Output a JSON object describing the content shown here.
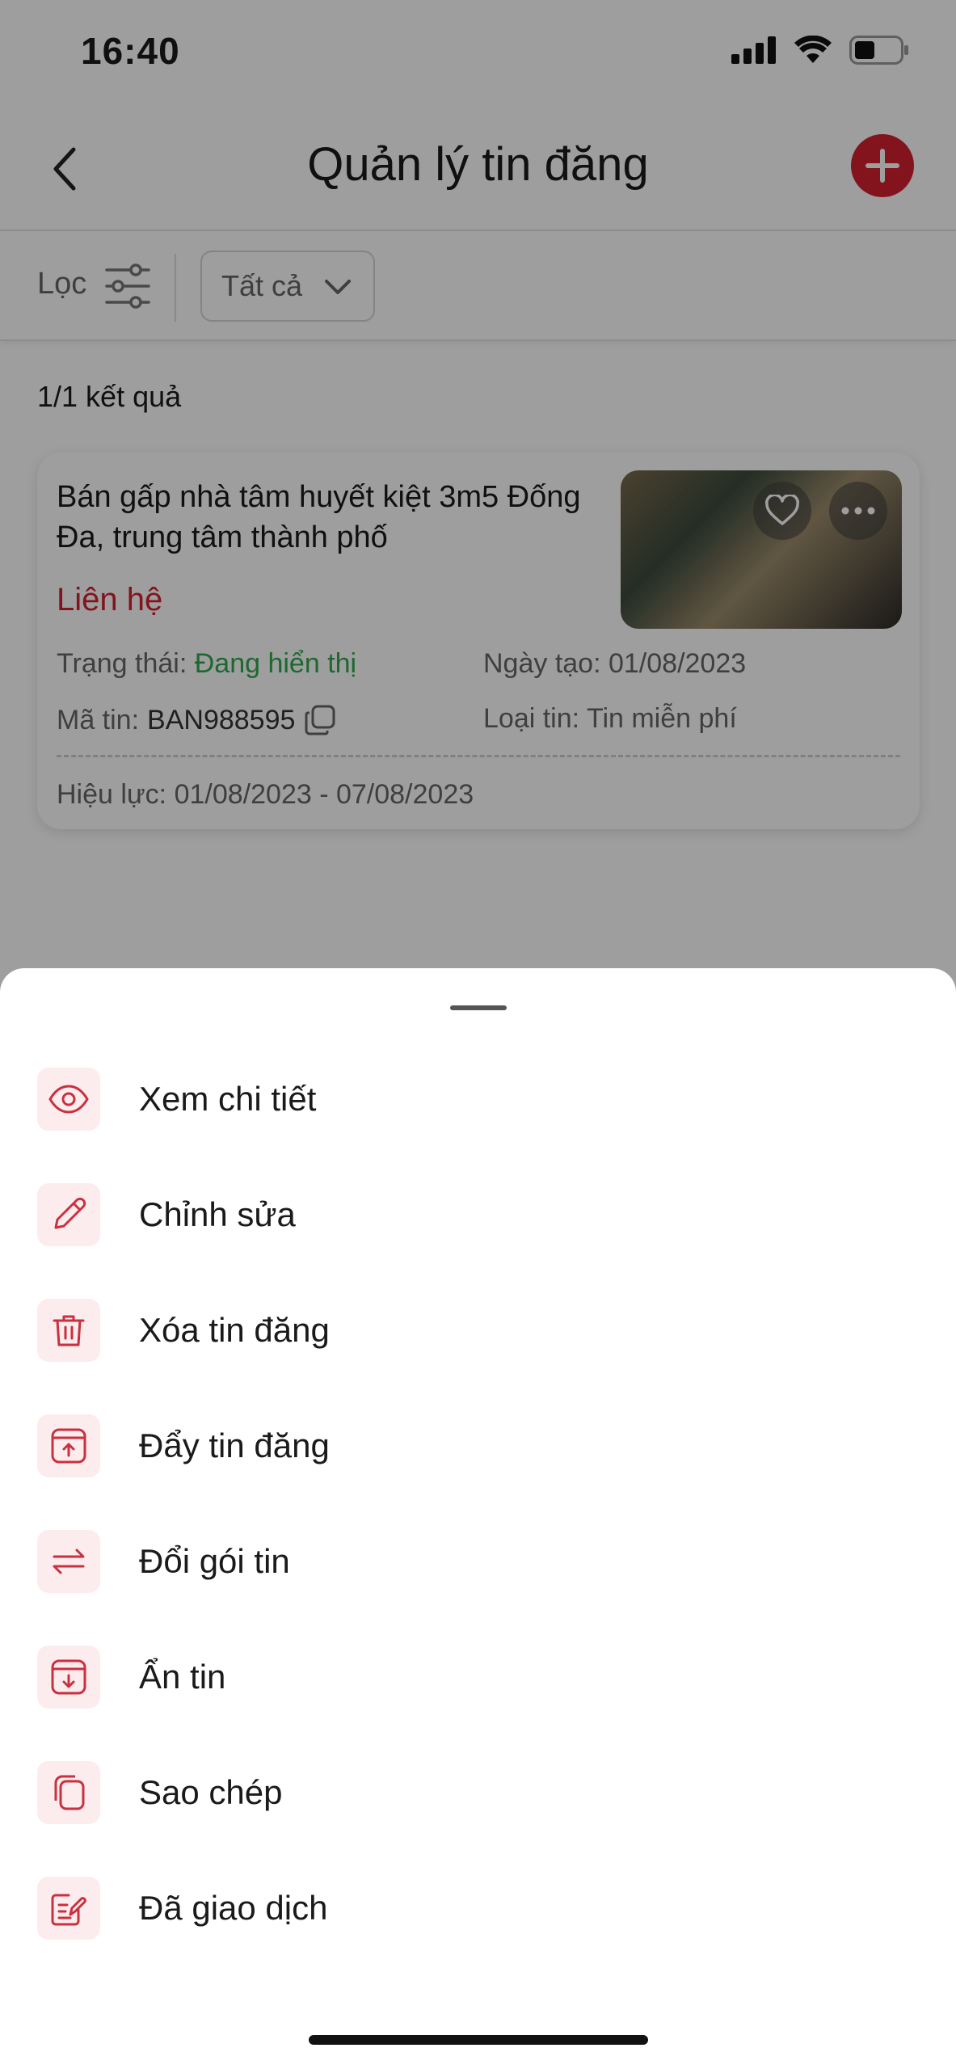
{
  "status": {
    "time": "16:40"
  },
  "header": {
    "title": "Quản lý tin đăng"
  },
  "filter": {
    "label": "Lọc",
    "dropdown_value": "Tất cả"
  },
  "results": {
    "count_text": "1/1 kết quả"
  },
  "listing": {
    "title": "Bán gấp nhà tâm huyết kiệt 3m5 Đống Đa, trung tâm thành phố",
    "price": "Liên hệ",
    "status_label": "Trạng thái:",
    "status_value": "Đang hiển thị",
    "created_label": "Ngày tạo:",
    "created_value": "01/08/2023",
    "code_label": "Mã tin:",
    "code_value": "BAN988595",
    "type_label": "Loại tin:",
    "type_value": "Tin miễn phí",
    "validity_label": "Hiệu lực:",
    "validity_value": "01/08/2023 - 07/08/2023"
  },
  "menu": {
    "items": [
      {
        "label": "Xem chi tiết",
        "icon": "eye-icon"
      },
      {
        "label": "Chỉnh sửa",
        "icon": "pencil-icon"
      },
      {
        "label": "Xóa tin đăng",
        "icon": "trash-icon"
      },
      {
        "label": "Đẩy tin đăng",
        "icon": "push-up-icon"
      },
      {
        "label": "Đổi gói tin",
        "icon": "swap-icon"
      },
      {
        "label": "Ẩn tin",
        "icon": "hide-icon"
      },
      {
        "label": "Sao chép",
        "icon": "copy-icon"
      },
      {
        "label": "Đã giao dịch",
        "icon": "transaction-done-icon"
      }
    ]
  },
  "colors": {
    "accent": "#d3212f",
    "status_green": "#2fa84f",
    "icon_bg": "#fdecee"
  }
}
